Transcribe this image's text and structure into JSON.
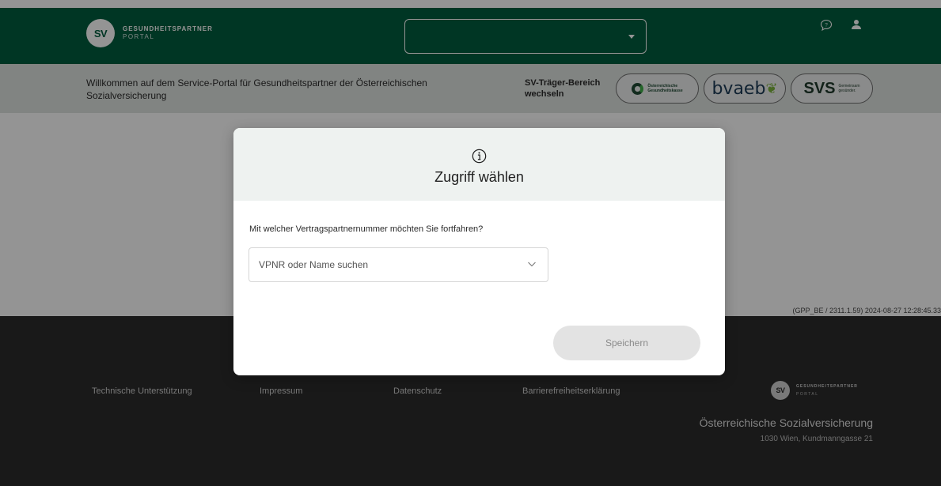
{
  "header": {
    "logo_line1": "GESUNDHEITSPARTNER",
    "logo_line2": "PORTAL",
    "logo_badge": "SV",
    "select_value": "",
    "help_icon": "help-bubble-icon",
    "user_icon": "user-icon"
  },
  "subheader": {
    "welcome": "Willkommen auf dem Service-Portal für Gesundheitspartner der Österreichischen Sozialversicherung",
    "switch_label": "SV-Träger-Bereich wechseln",
    "carriers": [
      {
        "name": "Österreichische Gesundheitskasse",
        "text_line1": "Österreichische",
        "text_line2": "Gesundheitskasse"
      },
      {
        "name": "bvaeb",
        "text": "bvaeb"
      },
      {
        "name": "SVS",
        "text": "SVS",
        "sub_line1": "Gemeinsam",
        "sub_line2": "gesünder."
      }
    ]
  },
  "main": {
    "build_info": "(GPP_BE / 2311.1.59) 2024-08-27 12:28:45.33"
  },
  "footer": {
    "links": [
      "Technische Unterstützung",
      "Impressum",
      "Datenschutz",
      "Barrierefreiheitserklärung"
    ],
    "logo_badge": "SV",
    "logo_line1": "GESUNDHEITSPARTNER",
    "logo_line2": "PORTAL",
    "org": "Österreichische Sozialversicherung",
    "address": "1030 Wien, Kundmanngasse 21"
  },
  "modal": {
    "icon": "info-icon",
    "title": "Zugriff wählen",
    "question": "Mit welcher Vertragspartnernummer möchten Sie fortfahren?",
    "select_placeholder": "VPNR oder Name suchen",
    "save_label": "Speichern"
  },
  "colors": {
    "brand_green": "#005e3f",
    "subheader_bg": "#dfe3e1",
    "footer_bg": "#2b2b2b",
    "disabled_button": "#e3e3e3"
  }
}
